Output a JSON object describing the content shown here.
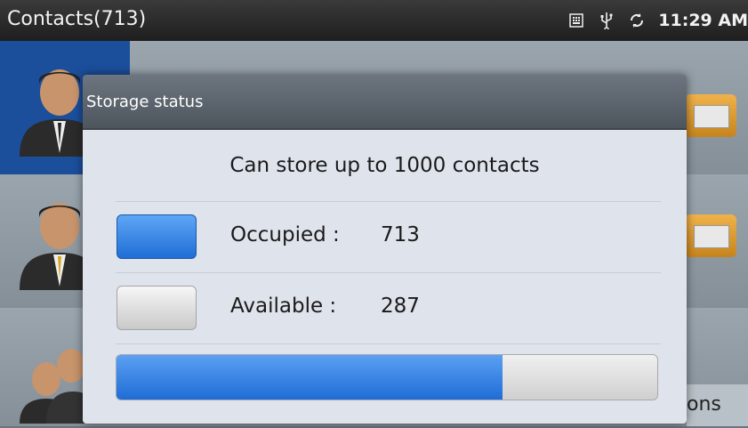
{
  "statusbar": {
    "title": "Contacts(713)",
    "icons": [
      "keyboard-icon",
      "usb-icon",
      "sync-icon"
    ],
    "time": "11:29 AM"
  },
  "background": {
    "tab_fragment": "ons"
  },
  "dialog": {
    "title": "Storage status",
    "capacity_text": "Can store up to 1000 contacts",
    "occupied": {
      "label": "Occupied :",
      "value": "713",
      "color": "#2f7fe3"
    },
    "available": {
      "label": "Available :",
      "value": "287",
      "color": "#d9d9d9"
    },
    "usage_fraction": 0.713
  }
}
